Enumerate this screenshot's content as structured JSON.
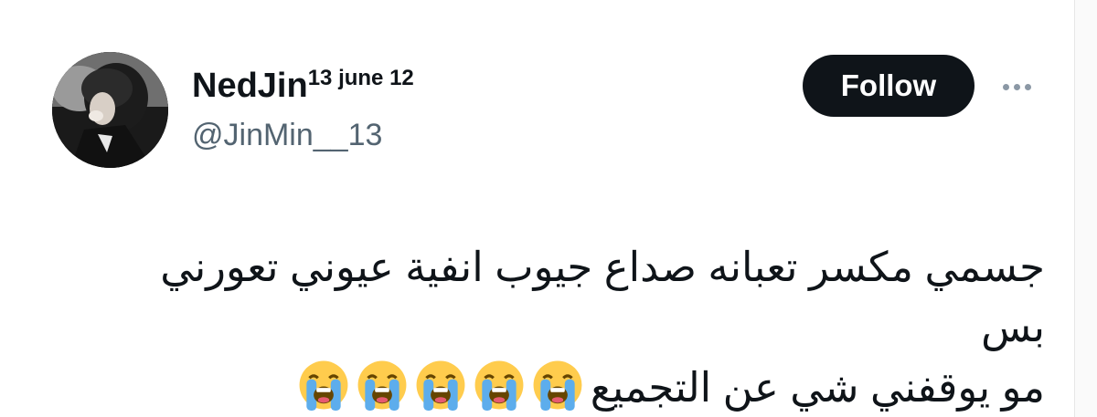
{
  "author": {
    "display_name": "NedJin",
    "name_suffix": "13 june 12",
    "handle": "@JinMin__13",
    "avatar_icon": "profile-photo"
  },
  "actions": {
    "follow_label": "Follow",
    "more_icon": "more-horizontal-icon"
  },
  "tweet": {
    "text_line1": "جسمي مكسر تعبانه صداع جيوب انفية عيوني تعورني بس",
    "text_line2": "مو يوقفني شي عن التجميع",
    "emoji_name": "loudly-crying-face-icon",
    "emoji_count": 5
  },
  "colors": {
    "text": "#0f1419",
    "secondary_text": "#536471",
    "button_bg": "#0f1419",
    "emoji_face": "#FFCC4D",
    "emoji_tears": "#5DADEC"
  }
}
